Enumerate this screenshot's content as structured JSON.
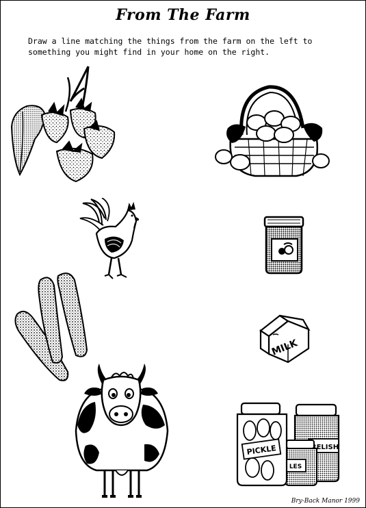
{
  "worksheet": {
    "title": "From The Farm",
    "instructions": [
      "Draw a line matching the things from the farm on the left to",
      "something you might find in your home on the right."
    ],
    "credit": "Bry-Back Manor 1999"
  },
  "left_items": [
    "strawberries-icon",
    "rooster-icon",
    "cucumbers-icon",
    "cow-icon"
  ],
  "right_items": [
    "egg-basket-icon",
    "jam-jar-icon",
    "milk-carton-icon",
    "pickle-jars-icon"
  ],
  "labels": {
    "milk": "MILK",
    "pickle": "PICKLE",
    "relish": "RELISH",
    "les": "LES"
  },
  "colors": {
    "ink": "#000000",
    "paper": "#ffffff"
  }
}
